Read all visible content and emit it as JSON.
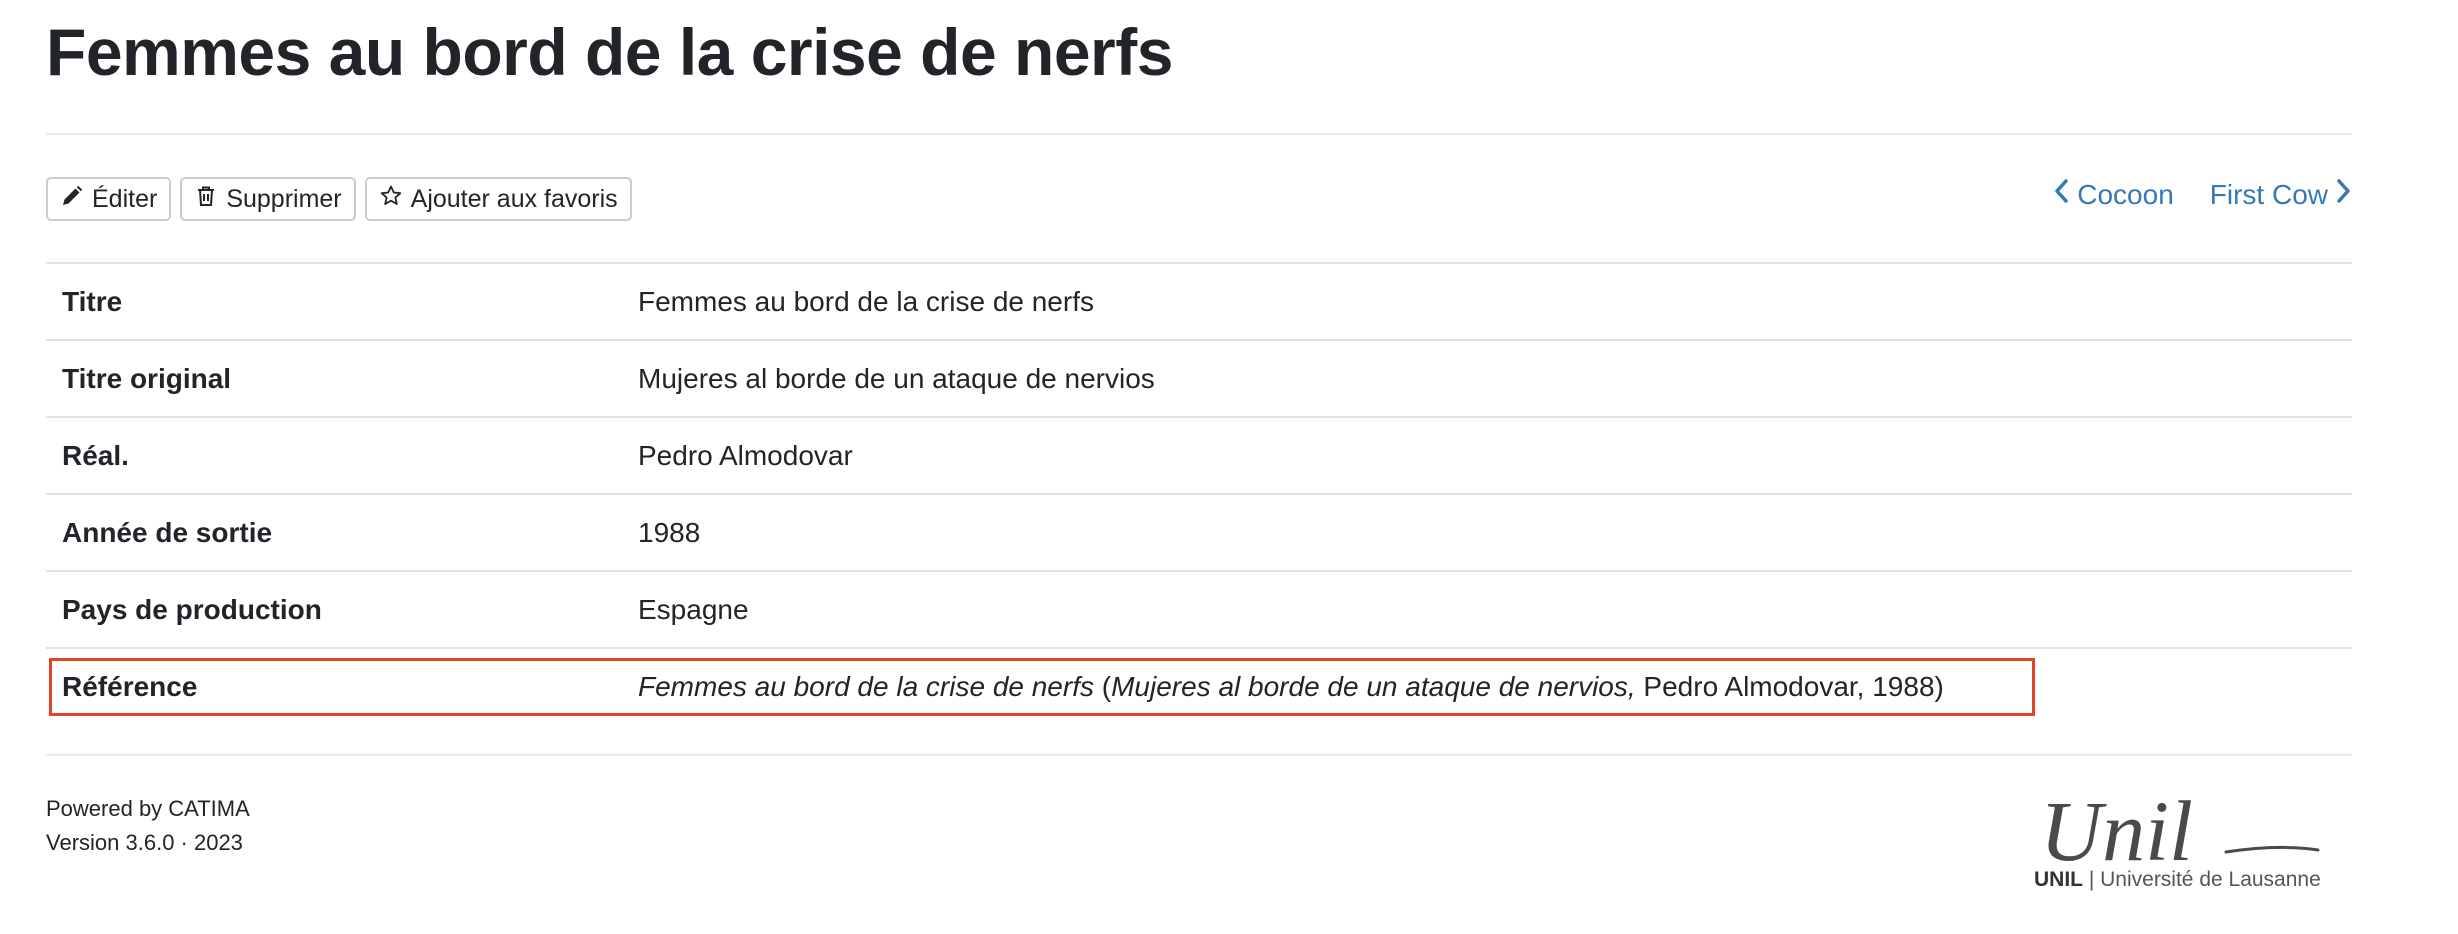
{
  "page": {
    "title": "Femmes au bord de la crise de nerfs"
  },
  "toolbar": {
    "edit_label": "Éditer",
    "delete_label": "Supprimer",
    "favorite_label": "Ajouter aux favoris"
  },
  "navigation": {
    "prev_label": "Cocoon",
    "next_label": "First Cow"
  },
  "details": {
    "rows": [
      {
        "label": "Titre",
        "value": "Femmes au bord de la crise de nerfs"
      },
      {
        "label": "Titre original",
        "value": "Mujeres al borde de un ataque de nervios"
      },
      {
        "label": "Réal.",
        "value": "Pedro Almodovar"
      },
      {
        "label": "Année de sortie",
        "value": "1988"
      },
      {
        "label": "Pays de production",
        "value": "Espagne"
      }
    ],
    "reference": {
      "label": "Référence",
      "title": "Femmes au bord de la crise de nerfs",
      "open": " (",
      "original_title": "Mujeres al borde de un ataque de nervios,",
      "rest": " Pedro Almodovar, 1988)"
    }
  },
  "footer": {
    "powered_by": "Powered by CATIMA",
    "version": "Version 3.6.0 · 2023",
    "logo_text": "Unil",
    "logo_short": "UNIL",
    "logo_separator": " | ",
    "logo_university": "Université de Lausanne"
  },
  "colors": {
    "link": "#337ab7",
    "highlight_border": "#e0442a",
    "text": "#212529"
  }
}
